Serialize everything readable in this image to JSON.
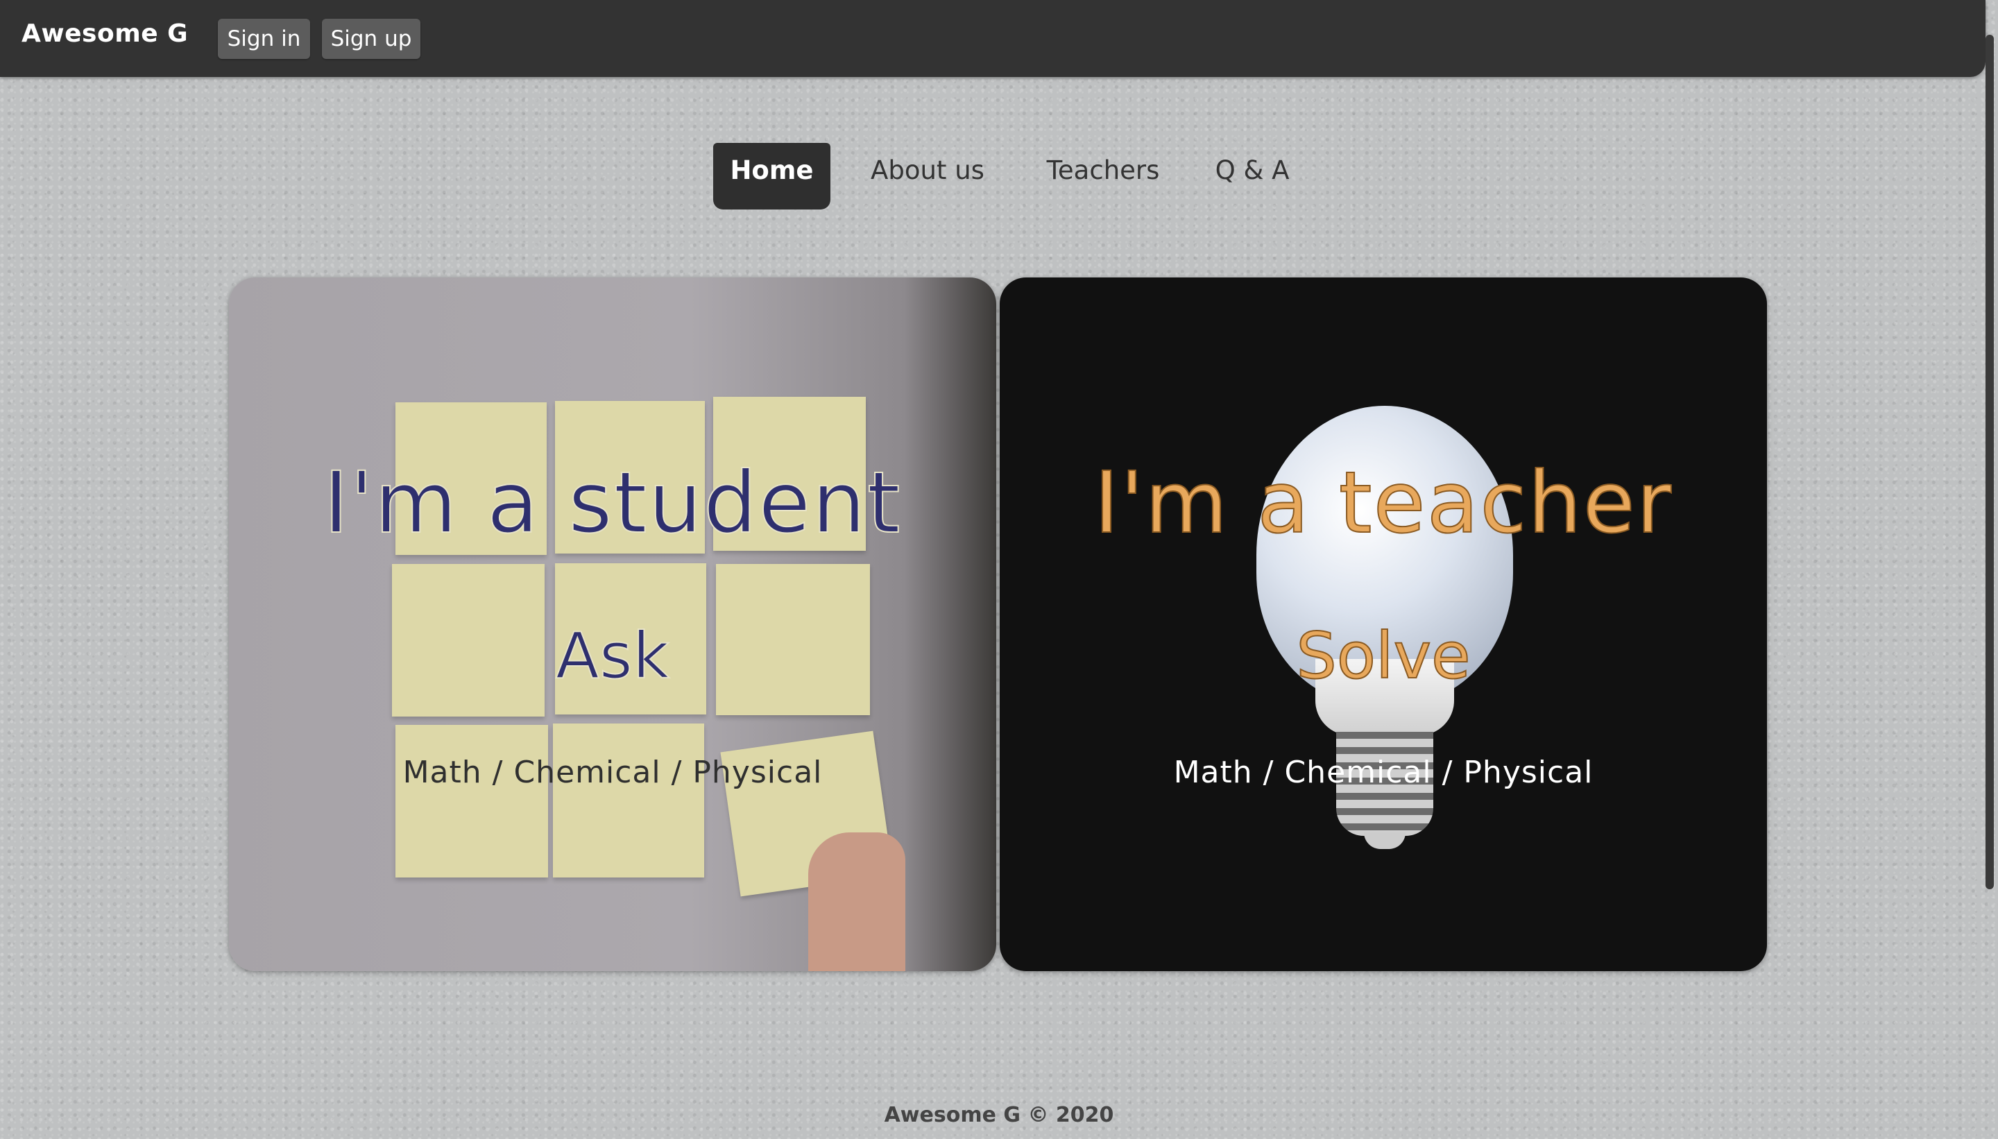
{
  "header": {
    "brand": "Awesome G",
    "sign_in": "Sign in",
    "sign_up": "Sign up"
  },
  "nav": {
    "home": "Home",
    "about": "About us",
    "teachers": "Teachers",
    "qa": "Q & A",
    "active": "Home"
  },
  "student_card": {
    "title": "I'm a student",
    "action": "Ask",
    "subjects": "Math / Chemical / Physical",
    "title_color": "#2e2f6e"
  },
  "teacher_card": {
    "title": "I'm a teacher",
    "action": "Solve",
    "subjects": "Math / Chemical / Physical",
    "title_color": "#e8a85c"
  },
  "footer": {
    "text": "Awesome G © 2020"
  }
}
